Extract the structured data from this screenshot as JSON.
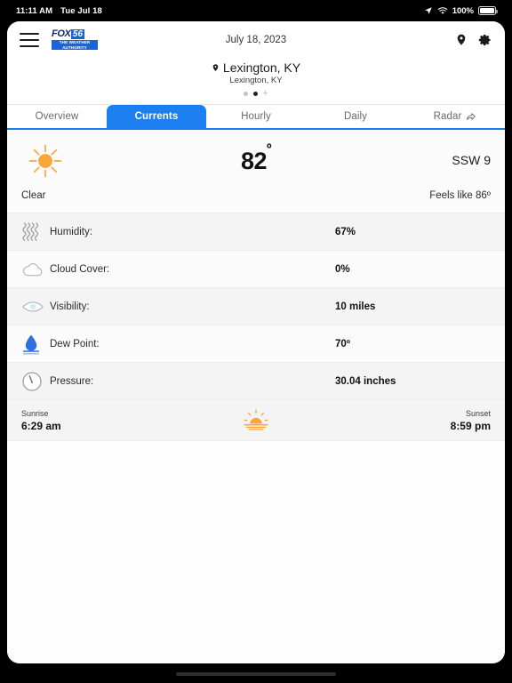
{
  "statusbar": {
    "time": "11:11 AM",
    "date": "Tue Jul 18",
    "location_icon": "location-arrow-icon",
    "wifi_icon": "wifi-icon",
    "battery_percent": "100%",
    "battery_icon": "battery-full-icon"
  },
  "header": {
    "menu_icon": "hamburger-menu-icon",
    "logo": {
      "brand": "FOX",
      "channel": "56",
      "tagline_line1": "THE WEATHER",
      "tagline_line2": "AUTHORITY"
    },
    "date": "July 18, 2023",
    "location_pin_icon": "location-pin-icon",
    "settings_icon": "gear-icon"
  },
  "location": {
    "pin_icon": "location-pin-icon",
    "primary": "Lexington, KY",
    "secondary": "Lexington, KY",
    "add_label": "+",
    "dots": [
      {
        "active": false
      },
      {
        "active": true
      }
    ]
  },
  "tabs": [
    {
      "label": "Overview",
      "active": false,
      "icon": null
    },
    {
      "label": "Currents",
      "active": true,
      "icon": null
    },
    {
      "label": "Hourly",
      "active": false,
      "icon": null
    },
    {
      "label": "Daily",
      "active": false,
      "icon": null
    },
    {
      "label": "Radar",
      "active": false,
      "icon": "external-link-arrow-icon"
    }
  ],
  "current": {
    "icon": "sun-clear-icon",
    "temperature": "82",
    "temperature_unit": "º",
    "condition": "Clear",
    "wind": "SSW 9",
    "feels_like": "Feels like 86º"
  },
  "details": [
    {
      "icon": "humidity-waves-icon",
      "label": "Humidity:",
      "value": "67%"
    },
    {
      "icon": "cloud-icon",
      "label": "Cloud Cover:",
      "value": "0%"
    },
    {
      "icon": "visibility-eye-icon",
      "label": "Visibility:",
      "value": "10 miles"
    },
    {
      "icon": "dew-point-drop-icon",
      "label": "Dew Point:",
      "value": "70º"
    },
    {
      "icon": "pressure-gauge-icon",
      "label": "Pressure:",
      "value": "30.04 inches"
    }
  ],
  "sun": {
    "sunrise_label": "Sunrise",
    "sunrise_time": "6:29 am",
    "sunset_label": "Sunset",
    "sunset_time": "8:59 pm",
    "icon": "sunrise-icon"
  },
  "colors": {
    "accent_blue": "#1b7ff0",
    "logo_blue": "#1964d8",
    "logo_navy": "#10246b",
    "sun_orange": "#f9a63a",
    "dew_blue": "#2f6fe4",
    "row_alt": "#f4f4f4"
  }
}
